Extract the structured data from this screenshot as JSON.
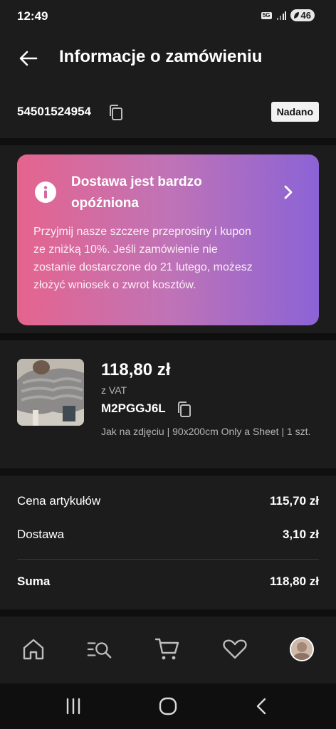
{
  "status_bar": {
    "time": "12:49",
    "network": "5G",
    "battery": "46"
  },
  "app_bar": {
    "title": "Informacje o zamówieniu"
  },
  "order": {
    "number": "54501524954",
    "status": "Nadano"
  },
  "alert": {
    "title": "Dostawa jest bardzo opóźniona",
    "body": "Przyjmij nasze szczere przeprosiny i kupon ze zniżką 10%. Jeśli zamówienie nie zostanie dostarczone do 21 lutego, możesz złożyć wniosek o zwrot kosztów."
  },
  "product": {
    "price": "118,80 zł",
    "vat": "z VAT",
    "sku": "M2PGGJ6L",
    "variant": "Jak na zdjęciu | 90x200cm Only a Sheet | 1 szt."
  },
  "summary": {
    "items_label": "Cena artykułów",
    "items_value": "115,70 zł",
    "shipping_label": "Dostawa",
    "shipping_value": "3,10 zł",
    "total_label": "Suma",
    "total_value": "118,80 zł"
  },
  "colors": {
    "gradient_start": "#e5648e",
    "gradient_end": "#8b63d6",
    "surface": "#1c1c1c",
    "background": "#0f0f0f"
  },
  "icons": [
    "arrow-left-icon",
    "copy-icon",
    "info-icon",
    "chevron-right-icon",
    "home-icon",
    "search-list-icon",
    "cart-icon",
    "heart-icon",
    "avatar",
    "recent-apps-icon",
    "home-circle-icon",
    "back-chevron-icon"
  ]
}
